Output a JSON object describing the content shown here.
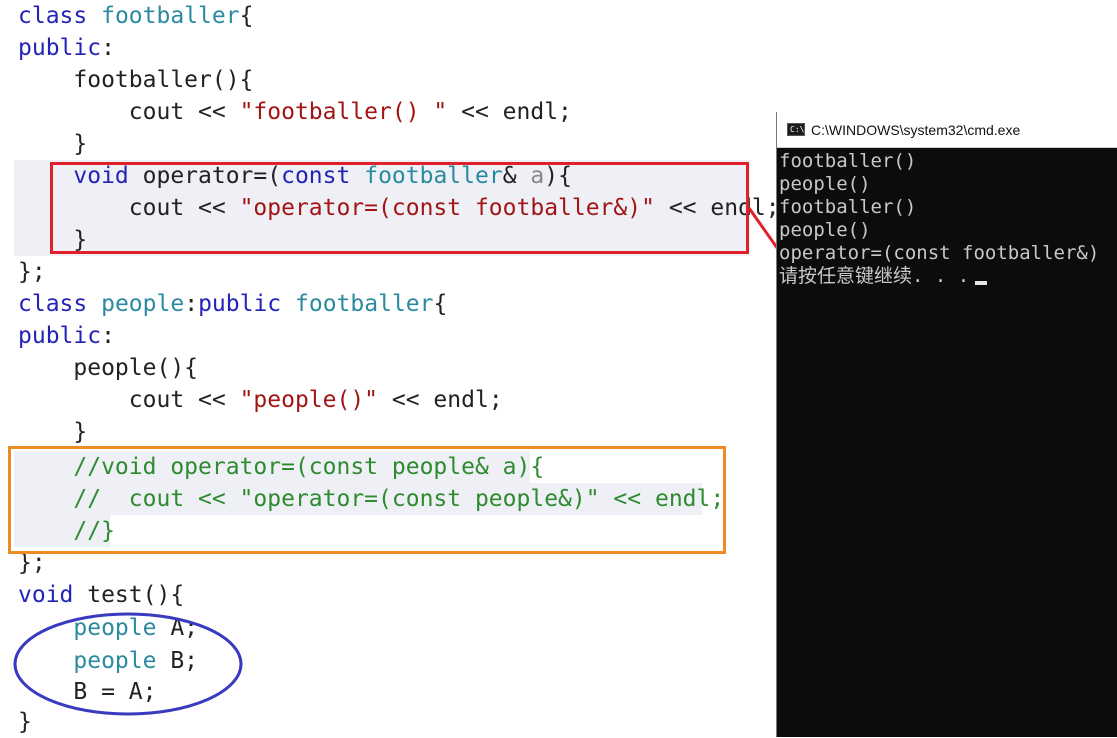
{
  "code": {
    "l1": {
      "k": "class",
      "sp": " ",
      "t": "footballer",
      "p": "{"
    },
    "l2": {
      "k": "public",
      "p": ":"
    },
    "l3": {
      "p": "    footballer(){"
    },
    "l4": {
      "a": "        cout << ",
      "s": "\"footballer() \"",
      "b": " << endl;"
    },
    "l5": {
      "p": "    }"
    },
    "l6": {
      "ind": "    ",
      "k1": "void",
      "a": " operator=(",
      "k2": "const",
      "sp": " ",
      "t": "footballer",
      "b": "& ",
      "g": "a",
      ")": "){"
    },
    "l7": {
      "a": "        cout << ",
      "s": "\"operator=(const footballer&)\"",
      "b": " << endl;"
    },
    "l8": {
      "p": "    }"
    },
    "l9": {
      "p": "};"
    },
    "l10": {
      "k": "class",
      "sp": " ",
      "t1": "people",
      "colon": ":",
      "k2": "public",
      "sp2": " ",
      "t2": "footballer",
      "p": "{"
    },
    "l11": {
      "k": "public",
      "p": ":"
    },
    "l12": {
      "p": "    people(){"
    },
    "l13": {
      "a": "        cout << ",
      "s": "\"people()\"",
      "b": " << endl;"
    },
    "l14": {
      "p": "    }"
    },
    "l15": {
      "ind": "    ",
      "c": "//void operator=(const people& a){"
    },
    "l16": {
      "ind": "    ",
      "c": "//  cout << \"operator=(const people&)\" << endl;"
    },
    "l17": {
      "ind": "    ",
      "c": "//}"
    },
    "l18": {
      "p": "};"
    },
    "l19": {
      "k": "void",
      "p": " test(){"
    },
    "l20": {
      "ind": "    ",
      "t": "people",
      "p": " A;"
    },
    "l21": {
      "ind": "    ",
      "t": "people",
      "p": " B;"
    },
    "l22": {
      "p": "    B = A;"
    },
    "l23": {
      "p": "}"
    }
  },
  "cmd": {
    "title": "C:\\WINDOWS\\system32\\cmd.exe",
    "icon_text": "C:\\",
    "lines": [
      "footballer()",
      "people()",
      "footballer()",
      "people()",
      "operator=(const footballer&)",
      "请按任意键继续. . ."
    ]
  },
  "colors": {
    "keyword": "#2323b8",
    "type": "#2b8aa0",
    "string": "#a31515",
    "comment": "#2e8b2e",
    "red_box": "#e0202a",
    "orange_box": "#f08a24",
    "blue_ellipse": "#3a3ac0"
  }
}
